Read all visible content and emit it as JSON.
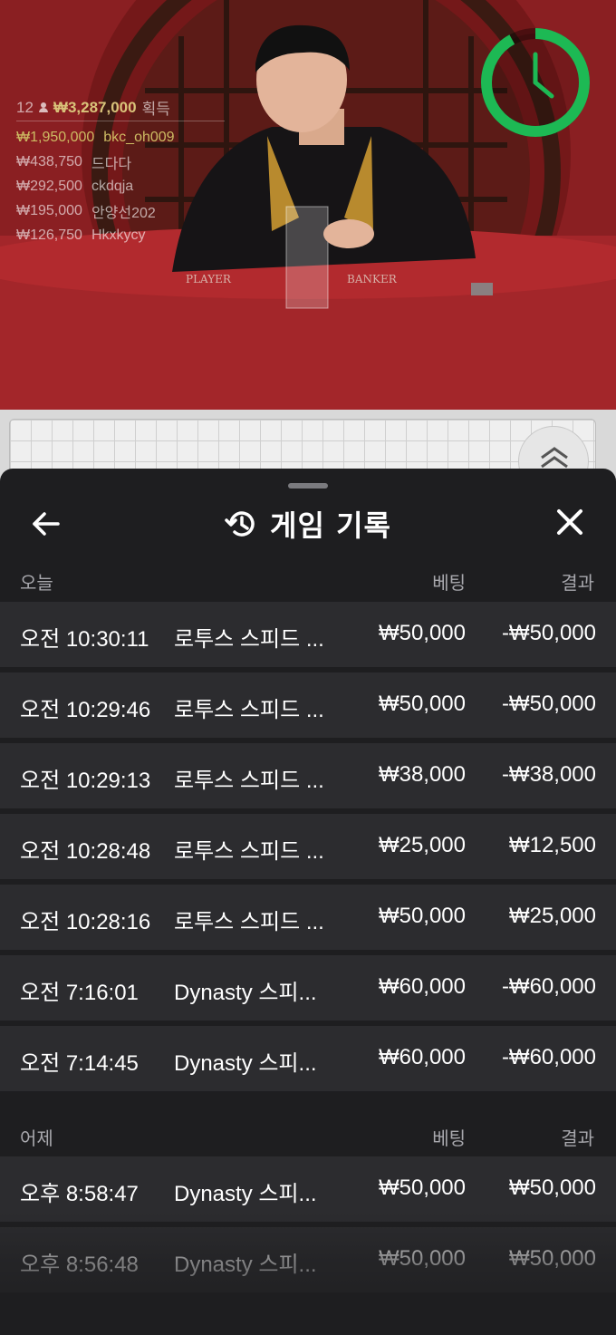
{
  "video": {
    "player_count": "12",
    "total_win": "₩3,287,000",
    "total_win_suffix": "획득",
    "winners": [
      {
        "amount": "₩1,950,000",
        "name": "bkc_oh009"
      },
      {
        "amount": "₩438,750",
        "name": "드다다"
      },
      {
        "amount": "₩292,500",
        "name": "ckdqja"
      },
      {
        "amount": "₩195,000",
        "name": "안양선202"
      },
      {
        "amount": "₩126,750",
        "name": "Hkxkycy"
      }
    ],
    "table_labels": {
      "player": "PLAYER",
      "banker": "BANKER"
    },
    "timer_fraction": 0.92,
    "timer_color": "#1db954"
  },
  "header": {
    "title": "게임 기록",
    "back_icon": "arrow-left-icon",
    "history_icon": "history-icon",
    "close_icon": "close-icon"
  },
  "sections": [
    {
      "label": "오늘",
      "bet_header": "베팅",
      "result_header": "결과",
      "rows": [
        {
          "time": "오전 10:30:11",
          "game": "로투스 스피드 ...",
          "bet": "₩50,000",
          "result": "-₩50,000"
        },
        {
          "time": "오전 10:29:46",
          "game": "로투스 스피드 ...",
          "bet": "₩50,000",
          "result": "-₩50,000"
        },
        {
          "time": "오전 10:29:13",
          "game": "로투스 스피드 ...",
          "bet": "₩38,000",
          "result": "-₩38,000"
        },
        {
          "time": "오전 10:28:48",
          "game": "로투스 스피드 ...",
          "bet": "₩25,000",
          "result": "₩12,500"
        },
        {
          "time": "오전 10:28:16",
          "game": "로투스 스피드 ...",
          "bet": "₩50,000",
          "result": "₩25,000"
        },
        {
          "time": "오전 7:16:01",
          "game": "Dynasty 스피...",
          "bet": "₩60,000",
          "result": "-₩60,000"
        },
        {
          "time": "오전 7:14:45",
          "game": "Dynasty 스피...",
          "bet": "₩60,000",
          "result": "-₩60,000"
        }
      ]
    },
    {
      "label": "어제",
      "bet_header": "베팅",
      "result_header": "결과",
      "rows": [
        {
          "time": "오후 8:58:47",
          "game": "Dynasty 스피...",
          "bet": "₩50,000",
          "result": "₩50,000"
        },
        {
          "time": "오후 8:56:48",
          "game": "Dynasty 스피...",
          "bet": "₩50,000",
          "result": "₩50,000"
        }
      ]
    }
  ]
}
